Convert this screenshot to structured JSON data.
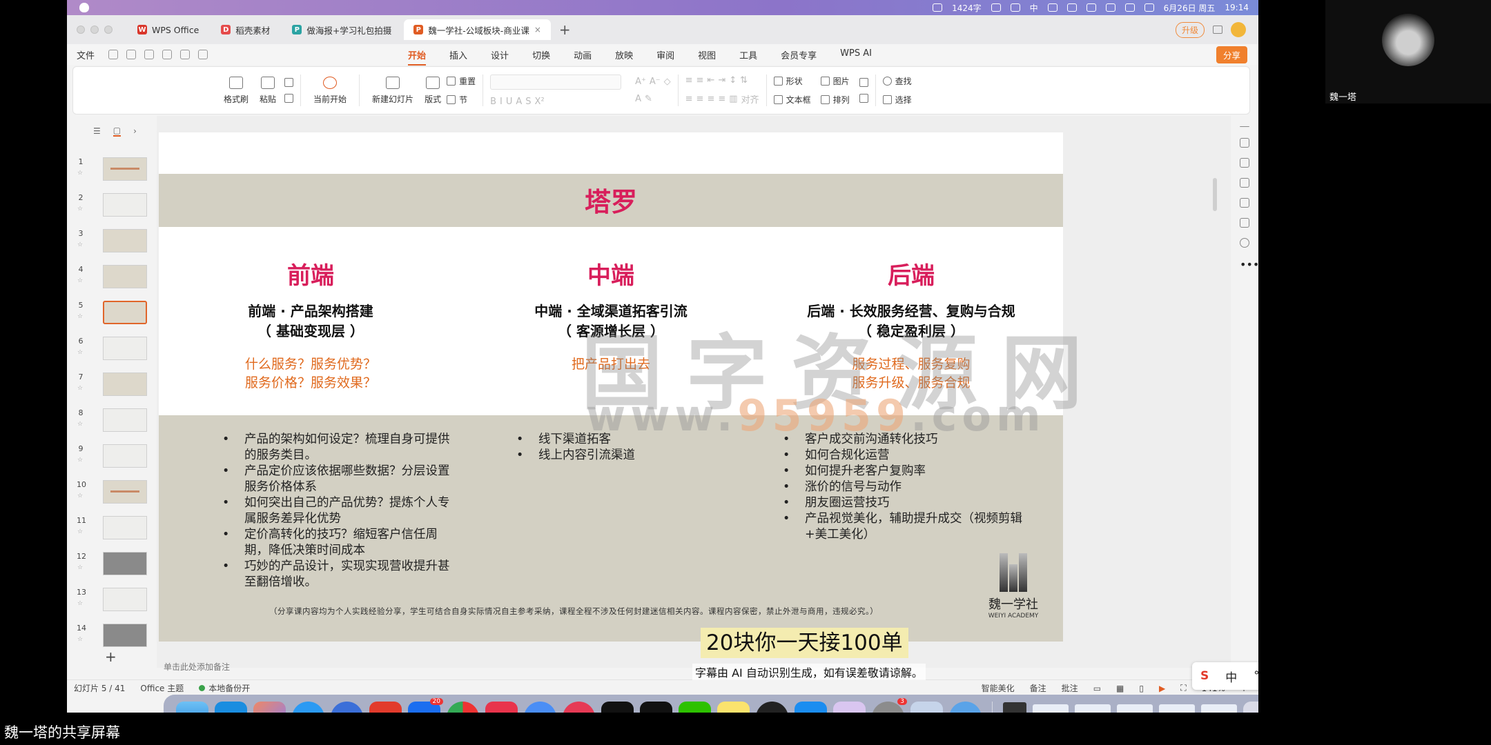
{
  "menubar": {
    "items": [
      "1424字",
      "中",
      "6月26日 周五",
      "19:14"
    ]
  },
  "tabs": [
    {
      "label": "WPS Office",
      "icon": "wps-icon",
      "color": "#d9362b"
    },
    {
      "label": "稻壳素材",
      "icon": "docer-icon",
      "color": "#e54b4b"
    },
    {
      "label": "做海报+学习礼包拍摄",
      "icon": "poster-icon",
      "color": "#2ba3a3"
    },
    {
      "label": "魏一学社-公域板块-商业课",
      "icon": "ppt-icon",
      "color": "#e05c23"
    }
  ],
  "titlebar": {
    "upgrade": "升级"
  },
  "menu": {
    "file": "文件",
    "tabs": [
      "开始",
      "插入",
      "设计",
      "切换",
      "动画",
      "放映",
      "审阅",
      "视图",
      "工具",
      "会员专享",
      "WPS AI"
    ],
    "share": "分享"
  },
  "ribbon": {
    "format_painter": "格式刷",
    "paste": "粘贴",
    "from_current": "当前开始",
    "new_slide": "新建幻灯片",
    "layout": "版式",
    "reset": "重置",
    "section": "节",
    "shape": "形状",
    "picture": "图片",
    "textbox": "文本框",
    "arrange": "排列",
    "find": "查找",
    "select": "选择",
    "align": "对齐"
  },
  "thumbnails": [
    "1",
    "2",
    "3",
    "4",
    "5",
    "6",
    "7",
    "8",
    "9",
    "10",
    "11",
    "12",
    "13",
    "14"
  ],
  "slide": {
    "title": "塔罗",
    "columns": [
      {
        "head": "前端",
        "title1": "前端 · 产品架构搭建",
        "title2": "（ 基础变现层 ）",
        "orange1": "什么服务？服务优势？",
        "orange2": "服务价格？服务效果？"
      },
      {
        "head": "中端",
        "title1": "中端 · 全域渠道拓客引流",
        "title2": "（ 客源增长层 ）",
        "orange1": "把产品打出去",
        "orange2": ""
      },
      {
        "head": "后端",
        "title1": "后端 · 长效服务经营、复购与合规",
        "title2": "（ 稳定盈利层 ）",
        "orange1": "服务过程、服务复购",
        "orange2": "服务升级、服务合规"
      }
    ],
    "bullets_left": [
      "产品的架构如何设定？梳理自身可提供的服务类目。",
      "产品定价应该依据哪些数据？分层设置服务价格体系",
      "如何突出自己的产品优势？提炼个人专属服务差异化优势",
      "定价高转化的技巧？缩短客户信任周期，降低决策时间成本",
      "巧妙的产品设计，实现实现营收提升甚至翻倍增收。"
    ],
    "bullets_mid": [
      "线下渠道拓客",
      "线上内容引流渠道"
    ],
    "bullets_right": [
      "客户成交前沟通转化技巧",
      "如何合规化运营",
      "如何提升老客户复购率",
      "涨价的信号与动作",
      "朋友圈运营技巧",
      "产品视觉美化，辅助提升成交（视频剪辑+美工美化）"
    ],
    "disclaimer": "（分享课内容均为个人实践经验分享，学生可结合自身实际情况自主参考采纳，课程全程不涉及任何封建迷信相关内容。课程内容保密，禁止外泄与商用，违规必究。）",
    "logo_cn": "魏一学社",
    "logo_en": "WEIYI ACADEMY"
  },
  "watermark": {
    "line1": "国字资源网",
    "www": "www.",
    "num": "95959",
    "com": ".com"
  },
  "notes_placeholder": "单击此处添加备注",
  "status": {
    "slide_count": "幻灯片 5 / 41",
    "theme": "Office 主题",
    "backup": "本地备份开",
    "beautify": "智能美化",
    "notes": "备注",
    "comments": "批注",
    "zoom": "141%"
  },
  "subtitles": {
    "main": "20块你一天接100单",
    "ai_notice": "字幕由 AI 自动识别生成，如有误差敬请谅解。"
  },
  "ime": {
    "lang": "中",
    "punct": "°,"
  },
  "webcam": {
    "name": "魏一塔"
  },
  "share_caption": "魏一塔的共享屏幕",
  "dock": {
    "badges": [
      "20",
      "3"
    ]
  }
}
